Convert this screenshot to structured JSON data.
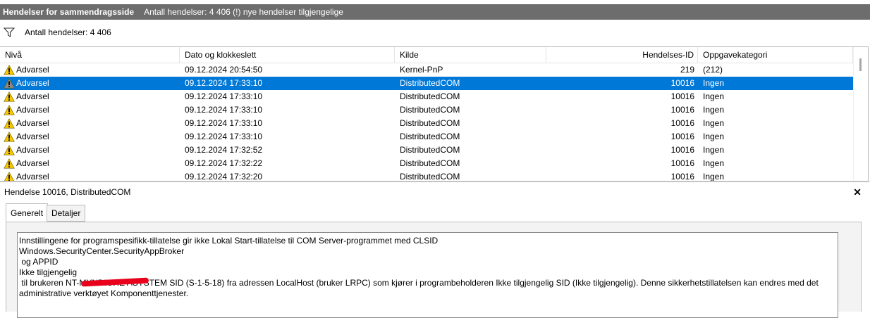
{
  "titlebar": {
    "title": "Hendelser for sammendragsside",
    "summary": "Antall hendelser: 4 406 (!) nye hendelser tilgjengelige"
  },
  "filter": {
    "icon": "filter-icon",
    "label": "Antall hendelser: 4 406"
  },
  "grid": {
    "columns": [
      "Nivå",
      "Dato og klokkeslett",
      "Kilde",
      "Hendelses-ID",
      "Oppgavekategori"
    ],
    "selected_row": 1,
    "rows": [
      {
        "level": "Advarsel",
        "date": "09.12.2024 20:54:50",
        "source": "Kernel-PnP",
        "id": "219",
        "category": "(212)"
      },
      {
        "level": "Advarsel",
        "date": "09.12.2024 17:33:10",
        "source": "DistributedCOM",
        "id": "10016",
        "category": "Ingen"
      },
      {
        "level": "Advarsel",
        "date": "09.12.2024 17:33:10",
        "source": "DistributedCOM",
        "id": "10016",
        "category": "Ingen"
      },
      {
        "level": "Advarsel",
        "date": "09.12.2024 17:33:10",
        "source": "DistributedCOM",
        "id": "10016",
        "category": "Ingen"
      },
      {
        "level": "Advarsel",
        "date": "09.12.2024 17:33:10",
        "source": "DistributedCOM",
        "id": "10016",
        "category": "Ingen"
      },
      {
        "level": "Advarsel",
        "date": "09.12.2024 17:33:10",
        "source": "DistributedCOM",
        "id": "10016",
        "category": "Ingen"
      },
      {
        "level": "Advarsel",
        "date": "09.12.2024 17:32:52",
        "source": "DistributedCOM",
        "id": "10016",
        "category": "Ingen"
      },
      {
        "level": "Advarsel",
        "date": "09.12.2024 17:32:22",
        "source": "DistributedCOM",
        "id": "10016",
        "category": "Ingen"
      },
      {
        "level": "Advarsel",
        "date": "09.12.2024 17:32:20",
        "source": "DistributedCOM",
        "id": "10016",
        "category": "Ingen"
      }
    ]
  },
  "detail": {
    "title": "Hendelse 10016, DistributedCOM",
    "close": "✕",
    "tabs": [
      "Generelt",
      "Detaljer"
    ],
    "lines": [
      "Innstillingene for programspesifikk-tillatelse gir ikke Lokal Start-tillatelse til COM Server-programmet med CLSID",
      "Windows.SecurityCenter.SecurityAppBroker",
      " og APPID",
      "Ikke tilgjengelig",
      " til brukeren NT-MYNDIGHET\\SYSTEM SID (S-1-5-18) fra adressen LocalHost (bruker LRPC) som kjører i programbeholderen Ikke tilgjengelig SID (Ikke tilgjengelig). Denne sikkerhetstillatelsen kan endres med det",
      "administrative verktøyet Komponenttjenester."
    ]
  },
  "colors": {
    "selection": "#0078d7",
    "titlebar": "#6d6d6d",
    "warning": "#f7c800"
  }
}
